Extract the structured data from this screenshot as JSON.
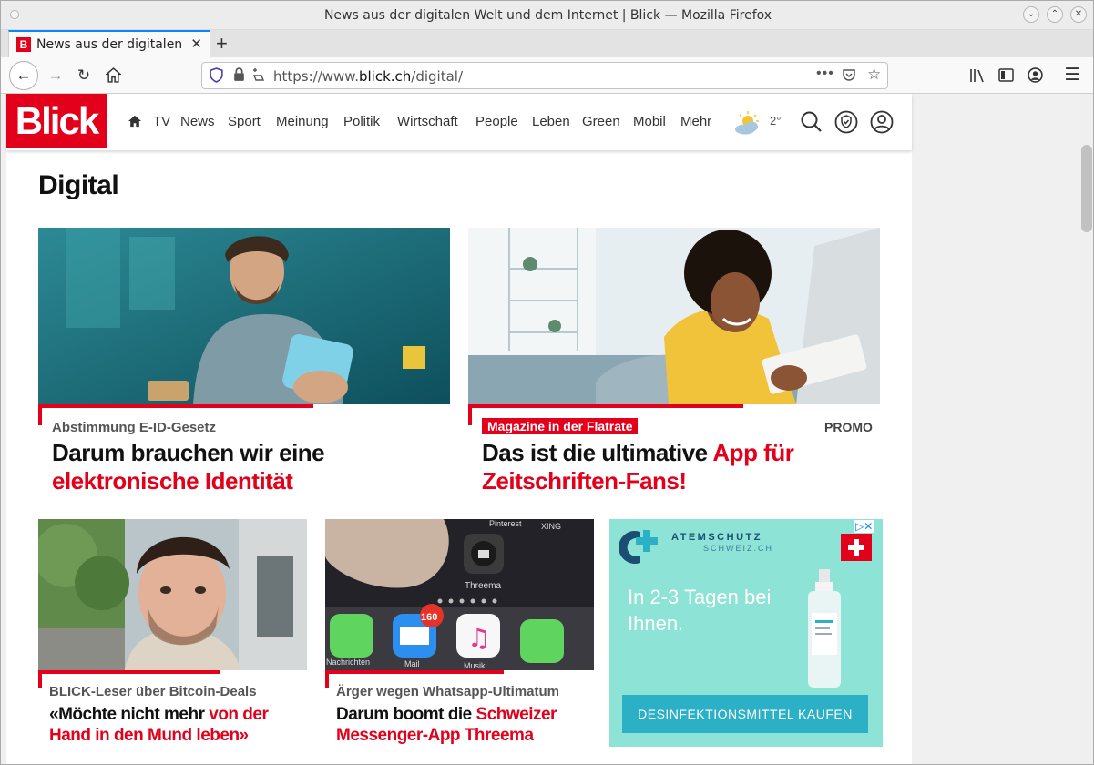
{
  "window": {
    "title": "News aus der digitalen Welt und dem Internet | Blick — Mozilla Firefox"
  },
  "tab": {
    "favicon": "B",
    "title": "News aus der digitalen Welt und dem Internet | Blick"
  },
  "urlbar": {
    "prefix": "https://www.",
    "domain": "blick.ch",
    "path": "/digital/"
  },
  "site": {
    "logo": "Blick",
    "nav": [
      "TV",
      "News",
      "Sport",
      "Meinung",
      "Politik",
      "Wirtschaft",
      "People",
      "Leben",
      "Green",
      "Mobil",
      "Mehr"
    ],
    "temperature": "2°",
    "section_title": "Digital"
  },
  "teasers": [
    {
      "kicker": "Abstimmung E-ID-Gesetz",
      "headline_black": "Darum brauchen wir eine ",
      "headline_red": "elektronische Identität"
    },
    {
      "badge": "Magazine in der Flatrate",
      "promo": "PROMO",
      "headline_black": "Das ist die ultimative ",
      "headline_red": "App für Zeitschriften-Fans!"
    },
    {
      "kicker": "BLICK-Leser über Bitcoin-Deals",
      "headline_black": "«Möchte nicht mehr ",
      "headline_red": "von der Hand in den Mund leben»"
    },
    {
      "kicker": "Ärger wegen Whatsapp-Ultimatum",
      "headline_black": "Darum boomt die ",
      "headline_red": "Schweizer Messenger-App Threema"
    }
  ],
  "ad": {
    "brand": "ATEMSCHUTZ",
    "brand_sub": "SCHWEIZ.CH",
    "tagline": "In 2-3 Tagen bei Ihnen.",
    "cta": "DESINFEKTIONSMITTEL KAUFEN"
  },
  "phone_screen": {
    "badge": "160",
    "labels": [
      "Pinterest",
      "XING",
      "Threema",
      "Nachrichten",
      "Mail",
      "Musik"
    ]
  }
}
